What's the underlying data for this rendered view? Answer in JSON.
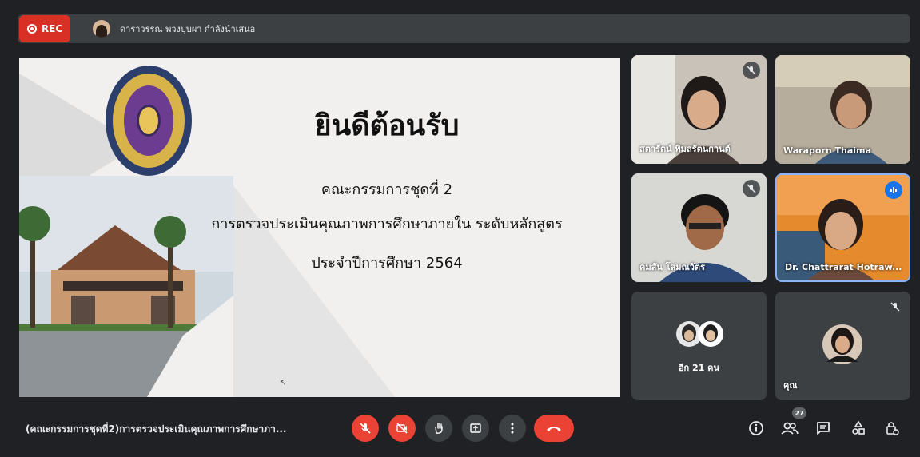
{
  "topbar": {
    "rec_label": "REC",
    "presenter_text": "ดาราวรรณ พวงบุบผา กำลังนำเสนอ"
  },
  "slide": {
    "title": "ยินดีต้อนรับ",
    "line1": "คณะกรรมการชุดที่ 2",
    "line2": "การตรวจประเมินคุณภาพการศึกษาภายใน ระดับหลักสูตร",
    "line3": "ประจำปีการศึกษา 2564",
    "accent_color": "#f47a20"
  },
  "participants": [
    {
      "name": "สตารัตน์ พิมลรัตนกานต์",
      "muted": true
    },
    {
      "name": "Waraporn Thaima",
      "muted": false
    },
    {
      "name": "คมสัน โสมณวัตร",
      "muted": true
    },
    {
      "name": "Dr. Chattrarat Hotraw...",
      "muted": false,
      "speaking": true
    },
    {
      "name": "อีก 21 คน"
    },
    {
      "name": "คุณ",
      "muted": true
    }
  ],
  "bottombar": {
    "meeting_title": "(คณะกรรมการชุดที่2)การตรวจประเมินคุณภาพการศึกษาภา...",
    "people_count": "27"
  },
  "icons": {
    "mic_off": "mic-off-icon",
    "cam_off": "camera-off-icon",
    "raise_hand": "hand-icon",
    "present": "present-icon",
    "more": "more-vert-icon",
    "end_call": "call-end-icon",
    "info": "info-icon",
    "people": "people-icon",
    "chat": "chat-icon",
    "activities": "activities-icon",
    "host_controls": "lock-person-icon"
  }
}
